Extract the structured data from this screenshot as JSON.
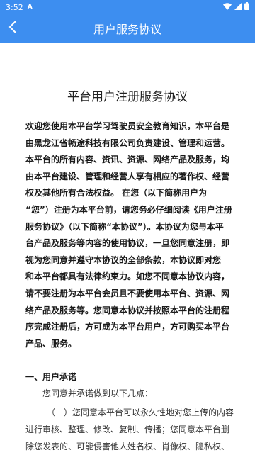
{
  "status": {
    "time": "3:52",
    "badge": "A"
  },
  "header": {
    "title": "用户服务协议"
  },
  "doc": {
    "title": "平台用户注册服务协议",
    "intro": [
      "欢迎您使用本平台学习驾驶员安全教育知识，本平台是",
      "由黑龙江省畅途科技有限公司负责建设、管理和运营。",
      "本平台的所有内容、资讯、资源、网络产品及服务，均",
      "由本平台建设、管理和经营人享有相应的著作权、经营",
      "权及其他所有合法权益。 在您（以下简称用户为",
      "“您”）注册为本平台前，请您务必仔细阅读《用户注册",
      "服务协议》（以下简称“本协议”）。本协议为您与本平",
      "台产品及服务等内容的使用协议，一旦您同意注册，即",
      "视为您同意并遵守本协议的全部条款，本协议即对您",
      "和本平台都具有法律约束力。如您不同意本协议内容，",
      "请不要注册为本平台会员且不要使用本平台、资源、网",
      "络产品及服务等。您同意本协议并按照本平台的注册程",
      "序完成注册后，方可成为本平台用户，方可购买本平台",
      "产品、服务。"
    ],
    "section1": {
      "heading": "一、用户承诺",
      "lead": "您同意并承诺做到以下几点：",
      "item1": [
        "（一）您同意本平台可以永久性地对您上传的内容",
        "进行审核、整理、修改、复制、传播；您同意本平台删",
        "除您发表的、可能侵害他人姓名权、肖像权、隐私权、"
      ]
    }
  }
}
